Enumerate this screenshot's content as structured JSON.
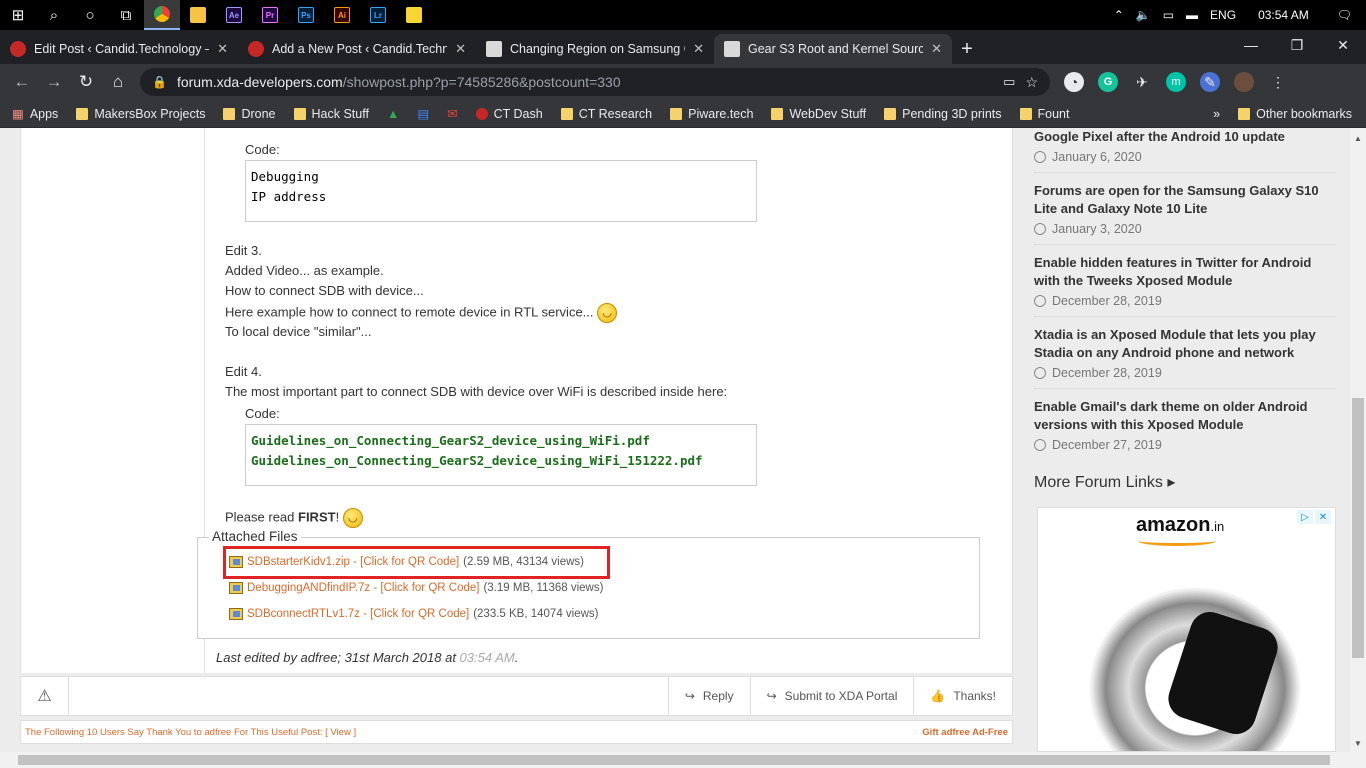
{
  "taskbar": {
    "apps": [
      {
        "name": "chrome",
        "label": "",
        "color": "#4285f4"
      },
      {
        "name": "explorer",
        "label": "",
        "color": "#f6c342"
      },
      {
        "name": "after-effects",
        "label": "Ae",
        "color": "#9999ff"
      },
      {
        "name": "premiere",
        "label": "Pr",
        "color": "#9999ff"
      },
      {
        "name": "photoshop",
        "label": "Ps",
        "color": "#31a8ff"
      },
      {
        "name": "illustrator",
        "label": "Ai",
        "color": "#ff9a00"
      },
      {
        "name": "lightroom",
        "label": "Lr",
        "color": "#31a8ff"
      },
      {
        "name": "sticky-notes",
        "label": "",
        "color": "#f7d633"
      }
    ],
    "language": "ENG",
    "time": "03:54 AM"
  },
  "tabs": [
    {
      "title": "Edit Post ‹ Candid.Technology —",
      "active": false
    },
    {
      "title": "Add a New Post ‹ Candid.Technol",
      "active": false
    },
    {
      "title": "Changing Region on Samsung Ge",
      "active": false
    },
    {
      "title": "Gear S3 Root and Kernel Source!",
      "active": true
    }
  ],
  "omnibox": {
    "host": "forum.xda-developers.com",
    "path": "/showpost.php?p=74585286&postcount=330"
  },
  "bookmarks": {
    "apps_label": "Apps",
    "items": [
      "MakersBox Projects",
      "Drone",
      "Hack Stuff",
      "",
      "",
      "",
      "CT Dash",
      "CT Research",
      "Piware.tech",
      "WebDev Stuff",
      "Pending 3D prints",
      "Fount"
    ],
    "overflow": "»",
    "other": "Other bookmarks"
  },
  "post": {
    "code_label": "Code:",
    "code1": [
      "Debugging",
      "IP address"
    ],
    "edit3": [
      "Edit 3.",
      "Added Video... as example.",
      "How to connect SDB with device...",
      "Here example how to connect to remote device in RTL service...",
      "To local device \"similar\"..."
    ],
    "edit4": [
      "Edit 4.",
      "The most important part to connect SDB with device over WiFi is described inside here:"
    ],
    "code2": [
      "Guidelines_on_Connecting_GearS2_device_using_WiFi.pdf",
      "Guidelines_on_Connecting_GearS2_device_using_WiFi_151222.pdf"
    ],
    "read_first_prefix": "Please read ",
    "read_first_bold": "FIRST",
    "read_first_suffix": "!",
    "attached_title": "Attached Files",
    "files": [
      {
        "name": "SDBstarterKidv1.zip - [Click for QR Code]",
        "meta": "(2.59 MB, 43134 views)"
      },
      {
        "name": "DebuggingANDfindIP.7z - [Click for QR Code]",
        "meta": "(3.19 MB, 11368 views)"
      },
      {
        "name": "SDBconnectRTLv1.7z - [Click for QR Code]",
        "meta": "(233.5 KB, 14074 views)"
      }
    ],
    "last_edited_prefix": "Last edited by adfree; 31st March 2018 at ",
    "last_edited_time": "03:54 AM",
    "last_edited_suffix": "."
  },
  "footer": {
    "reply": "Reply",
    "submit": "Submit to XDA Portal",
    "thanks": "Thanks!",
    "thanks_line": "The Following 10 Users Say Thank You to adfree For This Useful Post:  [ View ]",
    "gift": "Gift adfree Ad-Free"
  },
  "sidebar": {
    "items": [
      {
        "title": "Google Pixel after the Android 10 update",
        "date": "January 6, 2020"
      },
      {
        "title": "Forums are open for the Samsung Galaxy S10 Lite and Galaxy Note 10 Lite",
        "date": "January 3, 2020"
      },
      {
        "title": "Enable hidden features in Twitter for Android with the Tweeks Xposed Module",
        "date": "December 28, 2019"
      },
      {
        "title": "Xtadia is an Xposed Module that lets you play Stadia on any Android phone and network",
        "date": "December 28, 2019"
      },
      {
        "title": "Enable Gmail's dark theme on older Android versions with this Xposed Module",
        "date": "December 27, 2019"
      }
    ],
    "more_forum_links": "More Forum Links ▸",
    "ad_brand": "amazon",
    "ad_brand_suffix": ".in"
  }
}
